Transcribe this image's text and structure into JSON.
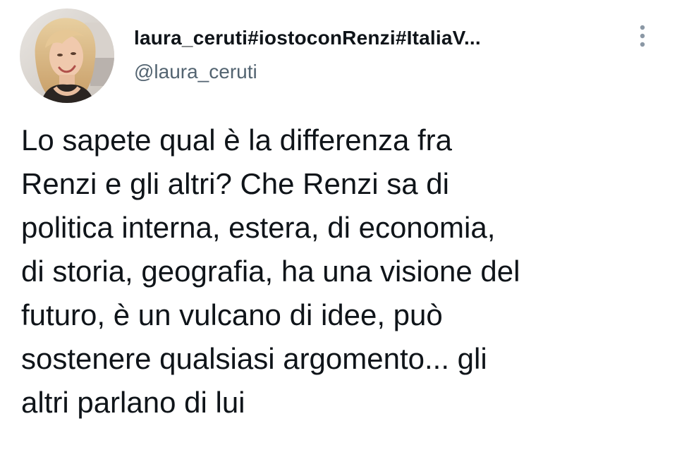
{
  "tweet": {
    "author": {
      "display_name": "laura_ceruti#iostoconRenzi#ItaliaV...",
      "handle": "@laura_ceruti"
    },
    "text": "Lo sapete qual è la differenza fra\nRenzi e gli altri? Che Renzi sa di\npolitica interna, estera, di economia,\ndi storia, geografia, ha una visione del\nfuturo, è un vulcano di idee, può\nsostenere qualsiasi argomento... gli\naltri parlano di lui"
  },
  "icons": {
    "more": "more-vertical-icon",
    "avatar": "profile-photo"
  },
  "colors": {
    "text_primary": "#0f1419",
    "text_secondary": "#536471",
    "icon": "#8b98a5",
    "background": "#ffffff"
  }
}
